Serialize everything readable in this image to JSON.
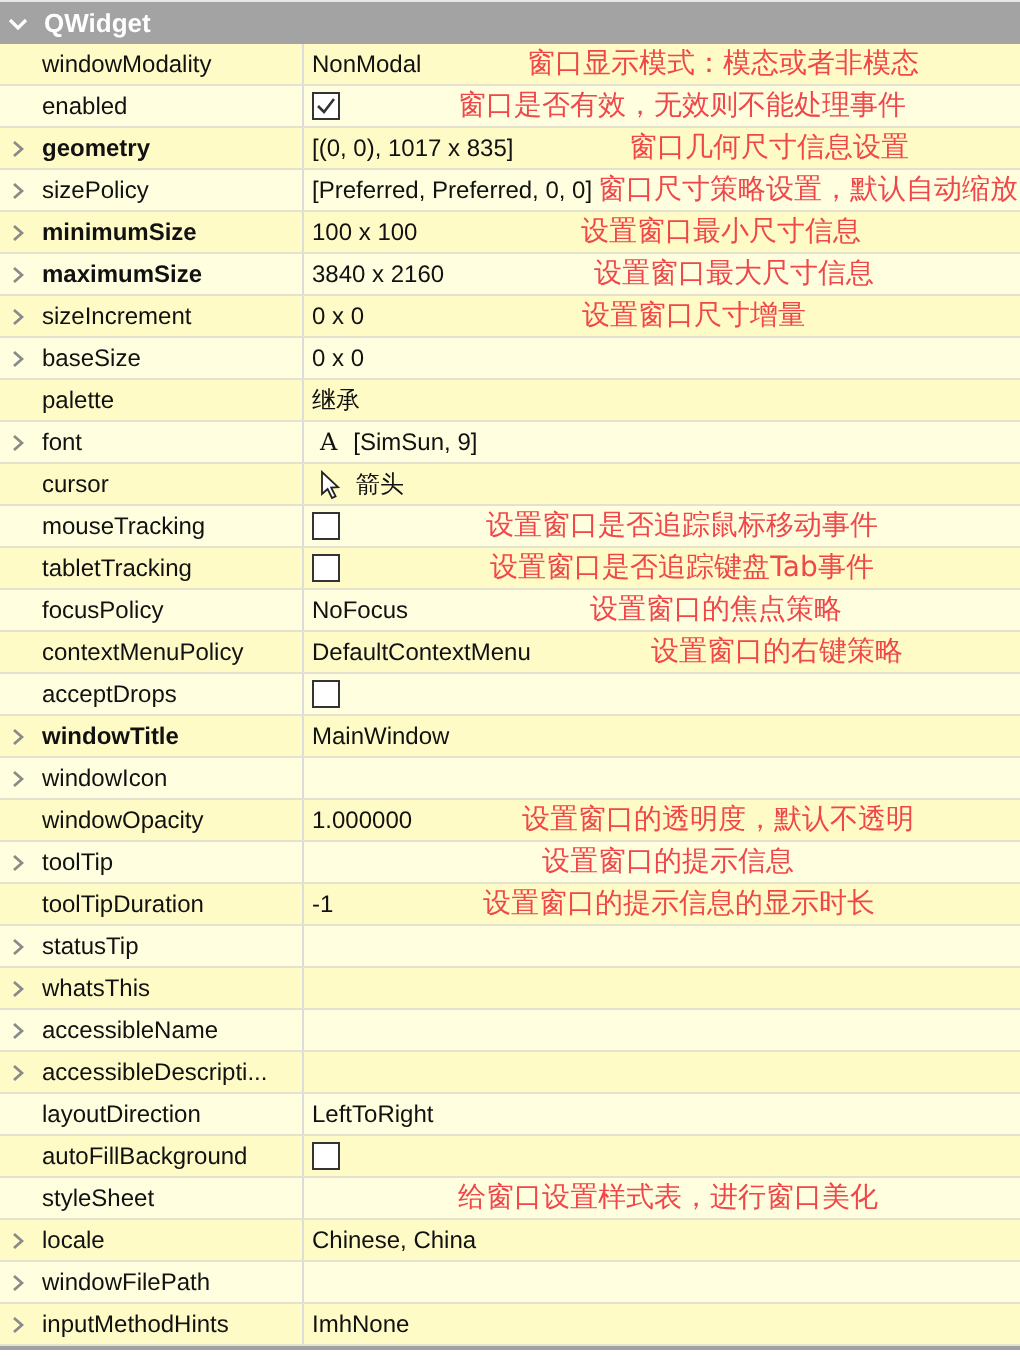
{
  "section": {
    "title": "QWidget",
    "expanded": true
  },
  "properties": [
    {
      "name": "windowModality",
      "bold": false,
      "expandable": false,
      "kind": "text",
      "value": "NonModal",
      "note": "窗口显示模式：模态或者非模态"
    },
    {
      "name": "enabled",
      "bold": false,
      "expandable": false,
      "kind": "checkbox",
      "checked": true,
      "note": "窗口是否有效，无效则不能处理事件"
    },
    {
      "name": "geometry",
      "bold": true,
      "expandable": true,
      "kind": "text",
      "value": "[(0, 0), 1017 x 835]",
      "note": "窗口几何尺寸信息设置"
    },
    {
      "name": "sizePolicy",
      "bold": false,
      "expandable": true,
      "kind": "text",
      "value": "[Preferred, Preferred, 0, 0]",
      "note": "窗口尺寸策略设置，默认自动缩放"
    },
    {
      "name": "minimumSize",
      "bold": true,
      "expandable": true,
      "kind": "text",
      "value": "100 x 100",
      "note": "设置窗口最小尺寸信息"
    },
    {
      "name": "maximumSize",
      "bold": true,
      "expandable": true,
      "kind": "text",
      "value": "3840 x 2160",
      "note": "设置窗口最大尺寸信息"
    },
    {
      "name": "sizeIncrement",
      "bold": false,
      "expandable": true,
      "kind": "text",
      "value": "0 x 0",
      "note": "设置窗口尺寸增量"
    },
    {
      "name": "baseSize",
      "bold": false,
      "expandable": true,
      "kind": "text",
      "value": "0 x 0"
    },
    {
      "name": "palette",
      "bold": false,
      "expandable": false,
      "kind": "text",
      "value": "继承"
    },
    {
      "name": "font",
      "bold": false,
      "expandable": true,
      "kind": "font",
      "glyph": "A",
      "value": "[SimSun, 9]"
    },
    {
      "name": "cursor",
      "bold": false,
      "expandable": false,
      "kind": "cursor",
      "value": "箭头"
    },
    {
      "name": "mouseTracking",
      "bold": false,
      "expandable": false,
      "kind": "checkbox",
      "checked": false,
      "note": "设置窗口是否追踪鼠标移动事件"
    },
    {
      "name": "tabletTracking",
      "bold": false,
      "expandable": false,
      "kind": "checkbox",
      "checked": false,
      "note": "设置窗口是否追踪键盘Tab事件"
    },
    {
      "name": "focusPolicy",
      "bold": false,
      "expandable": false,
      "kind": "text",
      "value": "NoFocus",
      "note": "设置窗口的焦点策略"
    },
    {
      "name": "contextMenuPolicy",
      "bold": false,
      "expandable": false,
      "kind": "text",
      "value": "DefaultContextMenu",
      "note": "设置窗口的右键策略"
    },
    {
      "name": "acceptDrops",
      "bold": false,
      "expandable": false,
      "kind": "checkbox",
      "checked": false
    },
    {
      "name": "windowTitle",
      "bold": true,
      "expandable": true,
      "kind": "text",
      "value": "MainWindow"
    },
    {
      "name": "windowIcon",
      "bold": false,
      "expandable": true,
      "kind": "empty"
    },
    {
      "name": "windowOpacity",
      "bold": false,
      "expandable": false,
      "kind": "text",
      "value": "1.000000",
      "note": "设置窗口的透明度，默认不透明"
    },
    {
      "name": "toolTip",
      "bold": false,
      "expandable": true,
      "kind": "empty",
      "note": "设置窗口的提示信息"
    },
    {
      "name": "toolTipDuration",
      "bold": false,
      "expandable": false,
      "kind": "text",
      "value": "-1",
      "note": "设置窗口的提示信息的显示时长"
    },
    {
      "name": "statusTip",
      "bold": false,
      "expandable": true,
      "kind": "empty"
    },
    {
      "name": "whatsThis",
      "bold": false,
      "expandable": true,
      "kind": "empty"
    },
    {
      "name": "accessibleName",
      "bold": false,
      "expandable": true,
      "kind": "empty"
    },
    {
      "name": "accessibleDescripti...",
      "bold": false,
      "expandable": true,
      "kind": "empty"
    },
    {
      "name": "layoutDirection",
      "bold": false,
      "expandable": false,
      "kind": "text",
      "value": "LeftToRight"
    },
    {
      "name": "autoFillBackground",
      "bold": false,
      "expandable": false,
      "kind": "checkbox",
      "checked": false
    },
    {
      "name": "styleSheet",
      "bold": false,
      "expandable": false,
      "kind": "empty",
      "note": "给窗口设置样式表，进行窗口美化"
    },
    {
      "name": "locale",
      "bold": false,
      "expandable": true,
      "kind": "text",
      "value": "Chinese, China"
    },
    {
      "name": "windowFilePath",
      "bold": false,
      "expandable": true,
      "kind": "empty"
    },
    {
      "name": "inputMethodHints",
      "bold": false,
      "expandable": true,
      "kind": "text",
      "value": "ImhNone"
    }
  ]
}
